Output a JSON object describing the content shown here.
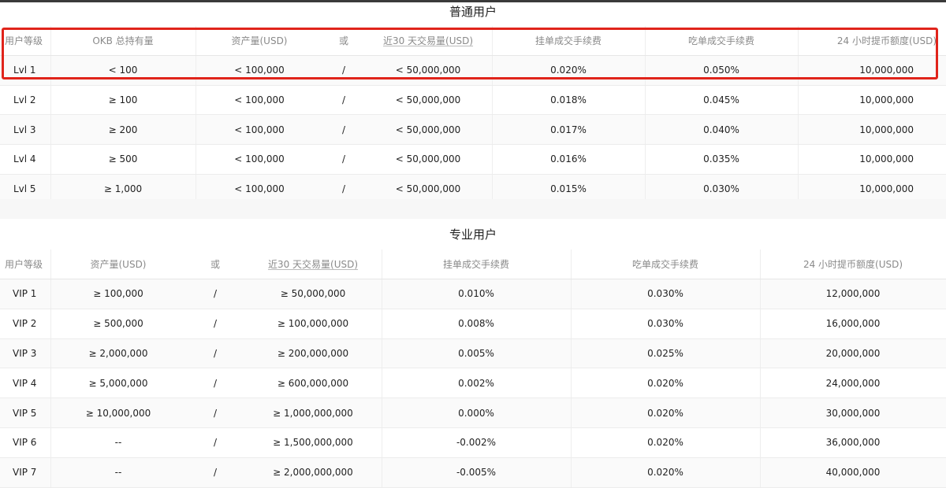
{
  "regular_users": {
    "title": "普通用户",
    "headers": [
      "用户等级",
      "OKB 总持有量",
      "资产量(USD)",
      "或",
      "近30 天交易量(USD)",
      "挂单成交手续费",
      "吃单成交手续费",
      "24 小时提币额度(USD)"
    ],
    "rows": [
      [
        "Lvl 1",
        "< 100",
        "< 100,000",
        "/",
        "< 50,000,000",
        "0.020%",
        "0.050%",
        "10,000,000"
      ],
      [
        "Lvl 2",
        "≥ 100",
        "< 100,000",
        "/",
        "< 50,000,000",
        "0.018%",
        "0.045%",
        "10,000,000"
      ],
      [
        "Lvl 3",
        "≥ 200",
        "< 100,000",
        "/",
        "< 50,000,000",
        "0.017%",
        "0.040%",
        "10,000,000"
      ],
      [
        "Lvl 4",
        "≥ 500",
        "< 100,000",
        "/",
        "< 50,000,000",
        "0.016%",
        "0.035%",
        "10,000,000"
      ],
      [
        "Lvl 5",
        "≥ 1,000",
        "< 100,000",
        "/",
        "< 50,000,000",
        "0.015%",
        "0.030%",
        "10,000,000"
      ]
    ]
  },
  "pro_users": {
    "title": "专业用户",
    "headers": [
      "用户等级",
      "资产量(USD)",
      "或",
      "近30 天交易量(USD)",
      "挂单成交手续费",
      "吃单成交手续费",
      "24 小时提币额度(USD)"
    ],
    "rows": [
      [
        "VIP 1",
        "≥ 100,000",
        "/",
        "≥ 50,000,000",
        "0.010%",
        "0.030%",
        "12,000,000"
      ],
      [
        "VIP 2",
        "≥ 500,000",
        "/",
        "≥ 100,000,000",
        "0.008%",
        "0.030%",
        "16,000,000"
      ],
      [
        "VIP 3",
        "≥ 2,000,000",
        "/",
        "≥ 200,000,000",
        "0.005%",
        "0.025%",
        "20,000,000"
      ],
      [
        "VIP 4",
        "≥ 5,000,000",
        "/",
        "≥ 600,000,000",
        "0.002%",
        "0.020%",
        "24,000,000"
      ],
      [
        "VIP 5",
        "≥ 10,000,000",
        "/",
        "≥ 1,000,000,000",
        "0.000%",
        "0.020%",
        "30,000,000"
      ],
      [
        "VIP 6",
        "--",
        "/",
        "≥ 1,500,000,000",
        "-0.002%",
        "0.020%",
        "36,000,000"
      ],
      [
        "VIP 7",
        "--",
        "/",
        "≥ 2,000,000,000",
        "-0.005%",
        "0.020%",
        "40,000,000"
      ]
    ]
  },
  "highlight": {
    "color": "#e0241b"
  }
}
